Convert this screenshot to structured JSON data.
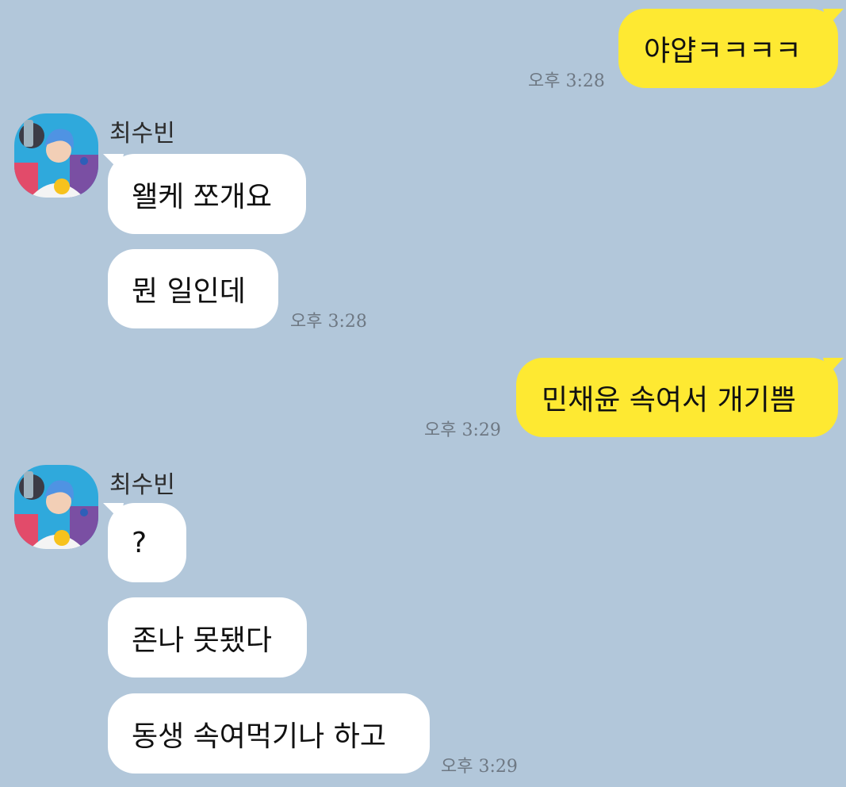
{
  "chat": {
    "colors": {
      "background": "#b2c7da",
      "my_bubble": "#fee932",
      "their_bubble": "#ffffff",
      "time_text": "#6e7883"
    },
    "contact_name": "최수빈",
    "groups": [
      {
        "sender": "me",
        "messages": [
          "야얍ㅋㅋㅋㅋ"
        ],
        "time": "오후 3:28"
      },
      {
        "sender": "최수빈",
        "messages": [
          "왤케 쪼개요",
          "뭔 일인데"
        ],
        "time": "오후 3:28"
      },
      {
        "sender": "me",
        "messages": [
          "민채윤 속여서 개기쁨"
        ],
        "time": "오후 3:29"
      },
      {
        "sender": "최수빈",
        "messages": [
          "?",
          "존나 못됐다",
          "동생 속여먹기나 하고"
        ],
        "time": "오후 3:29"
      }
    ]
  }
}
